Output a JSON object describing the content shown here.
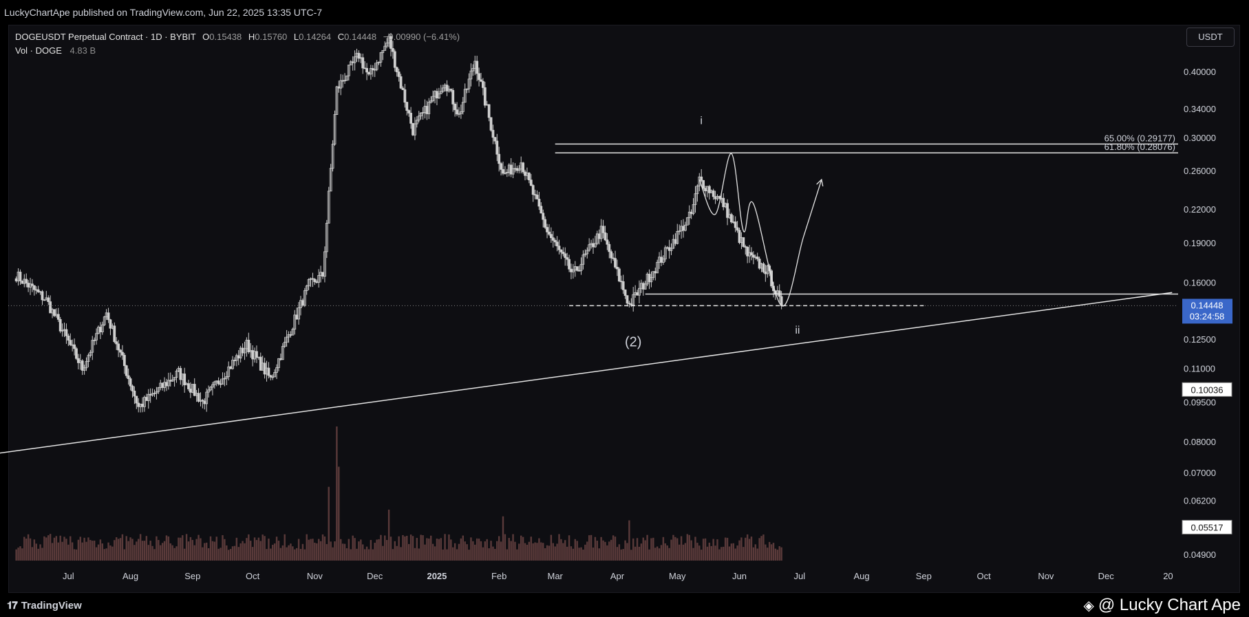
{
  "header": {
    "published": "LuckyChartApe published on TradingView.com, Jun 22, 2025 13:35 UTC-7"
  },
  "legend": {
    "symbol": "DOGEUSDT Perpetual Contract · 1D · BYBIT",
    "open_label": "O",
    "open": "0.15438",
    "high_label": "H",
    "high": "0.15760",
    "low_label": "L",
    "low": "0.14264",
    "close_label": "C",
    "close": "0.14448",
    "change": "−0.00990 (−6.41%)",
    "volume_label": "Vol · DOGE",
    "volume": "4.83 B"
  },
  "currency_button": "USDT",
  "footer": {
    "brand": "TradingView",
    "brand_icon": "tradingview-logo-icon",
    "author": "@ Lucky Chart Ape",
    "author_icon": "diamond-icon"
  },
  "colors": {
    "background": "#0e0e12",
    "candles": "#cfcfcf",
    "volume": "#5a3a3a",
    "lines": "#e6e6e6",
    "price_label": "#3a67c9"
  },
  "chart_data": {
    "type": "candlestick",
    "y_scale": "log",
    "ylim": [
      0.047,
      0.49
    ],
    "y_ticks": [
      "0.40000",
      "0.34000",
      "0.30000",
      "0.26000",
      "0.22000",
      "0.19000",
      "0.16000",
      "0.12500",
      "0.11000",
      "0.09500",
      "0.08000",
      "0.07000",
      "0.06200",
      "0.04900"
    ],
    "x_ticks": [
      "Jul",
      "Aug",
      "Sep",
      "Oct",
      "Nov",
      "Dec",
      "2025",
      "Feb",
      "Mar",
      "Apr",
      "May",
      "Jun",
      "Jul",
      "Aug",
      "Sep",
      "Oct",
      "Nov",
      "Dec",
      "20"
    ],
    "price_key_points": [
      {
        "date": "2024-06-05",
        "close": 0.165
      },
      {
        "date": "2024-06-20",
        "close": 0.148
      },
      {
        "date": "2024-07-08",
        "close": 0.11
      },
      {
        "date": "2024-07-20",
        "close": 0.14
      },
      {
        "date": "2024-08-05",
        "close": 0.093
      },
      {
        "date": "2024-08-25",
        "close": 0.108
      },
      {
        "date": "2024-09-06",
        "close": 0.095
      },
      {
        "date": "2024-09-28",
        "close": 0.122
      },
      {
        "date": "2024-10-10",
        "close": 0.105
      },
      {
        "date": "2024-10-29",
        "close": 0.158
      },
      {
        "date": "2024-11-05",
        "close": 0.165
      },
      {
        "date": "2024-11-12",
        "close": 0.37
      },
      {
        "date": "2024-11-23",
        "close": 0.43
      },
      {
        "date": "2024-11-28",
        "close": 0.39
      },
      {
        "date": "2024-12-08",
        "close": 0.46
      },
      {
        "date": "2024-12-20",
        "close": 0.31
      },
      {
        "date": "2025-01-05",
        "close": 0.385
      },
      {
        "date": "2025-01-12",
        "close": 0.33
      },
      {
        "date": "2025-01-20",
        "close": 0.42
      },
      {
        "date": "2025-02-03",
        "close": 0.255
      },
      {
        "date": "2025-02-12",
        "close": 0.27
      },
      {
        "date": "2025-02-25",
        "close": 0.2
      },
      {
        "date": "2025-03-10",
        "close": 0.165
      },
      {
        "date": "2025-03-24",
        "close": 0.2
      },
      {
        "date": "2025-04-07",
        "close": 0.145
      },
      {
        "date": "2025-04-22",
        "close": 0.175
      },
      {
        "date": "2025-05-08",
        "close": 0.215
      },
      {
        "date": "2025-05-12",
        "close": 0.25
      },
      {
        "date": "2025-05-24",
        "close": 0.225
      },
      {
        "date": "2025-06-05",
        "close": 0.18
      },
      {
        "date": "2025-06-15",
        "close": 0.168
      },
      {
        "date": "2025-06-22",
        "close": 0.1445
      }
    ],
    "volume_spikes": [
      {
        "date": "2024-11-08",
        "value": 0.55
      },
      {
        "date": "2024-11-12",
        "value": 1.0
      },
      {
        "date": "2024-11-13",
        "value": 0.7
      },
      {
        "date": "2024-12-08",
        "value": 0.38
      },
      {
        "date": "2025-02-03",
        "value": 0.33
      },
      {
        "date": "2025-04-07",
        "value": 0.3
      }
    ],
    "horizontal_levels": [
      {
        "label": "65.00% (0.29177)",
        "price": 0.29177,
        "x_start": "2025-03-01"
      },
      {
        "label": "61.80% (0.28076)",
        "price": 0.28076,
        "x_start": "2025-03-01"
      },
      {
        "price": 0.152,
        "x_start": "2025-04-15"
      },
      {
        "price": 0.1445,
        "x_start": "2025-03-08",
        "x_end": "2025-09-01",
        "dashed": true
      }
    ],
    "trendline": {
      "p1": {
        "date": "2024-05-23",
        "price": 0.0757
      },
      "p2": {
        "date": "2026-01-03",
        "price": 0.153
      }
    },
    "projection_path": [
      {
        "date": "2025-05-12",
        "price": 0.25
      },
      {
        "date": "2025-05-20",
        "price": 0.215
      },
      {
        "date": "2025-05-28",
        "price": 0.28
      },
      {
        "date": "2025-06-03",
        "price": 0.2
      },
      {
        "date": "2025-06-08",
        "price": 0.225
      },
      {
        "date": "2025-06-22",
        "price": 0.1445
      },
      {
        "date": "2025-07-03",
        "price": 0.195
      },
      {
        "date": "2025-07-12",
        "price": 0.25
      }
    ],
    "wave_labels": [
      {
        "text": "i",
        "date": "2025-05-13",
        "price": 0.318
      },
      {
        "text": "(2)",
        "date": "2025-04-09",
        "price": 0.121
      },
      {
        "text": "ii",
        "date": "2025-06-30",
        "price": 0.128
      }
    ],
    "price_labels": [
      {
        "value": "0.14448",
        "countdown": "03:24:58",
        "price": 0.14448,
        "style": "current"
      },
      {
        "value": "0.10036",
        "price": 0.10036,
        "style": "outline"
      },
      {
        "value": "0.05517",
        "price": 0.05517,
        "style": "outline"
      }
    ],
    "reference_line": {
      "price": 0.14448,
      "style": "dotted"
    }
  }
}
